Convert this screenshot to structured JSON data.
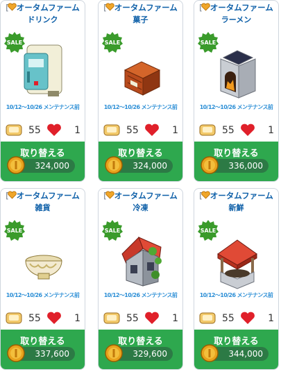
{
  "items": [
    {
      "title": "オータムファーム",
      "subtitle": "ドリンク",
      "sale": "SALE",
      "notice": "10/12～10/26 メンテナンス前",
      "stat_a": "55",
      "stat_b": "1",
      "button": "取り替える",
      "price": "324,000",
      "art": "fridge-icon"
    },
    {
      "title": "オータムファーム",
      "subtitle": "菓子",
      "sale": "SALE",
      "notice": "10/12～10/26 メンテナンス前",
      "stat_a": "55",
      "stat_b": "1",
      "button": "取り替える",
      "price": "324,000",
      "art": "crate-icon"
    },
    {
      "title": "オータムファーム",
      "subtitle": "ラーメン",
      "sale": "SALE",
      "notice": "10/12～10/26 メンテナンス前",
      "stat_a": "55",
      "stat_b": "1",
      "button": "取り替える",
      "price": "336,000",
      "art": "oven-icon"
    },
    {
      "title": "オータムファーム",
      "subtitle": "雑貨",
      "sale": "SALE",
      "notice": "10/12～10/26 メンテナンス前",
      "stat_a": "55",
      "stat_b": "1",
      "button": "取り替える",
      "price": "337,600",
      "art": "bowl-icon"
    },
    {
      "title": "オータムファーム",
      "subtitle": "冷凍",
      "sale": "SALE",
      "notice": "10/12～10/26 メンテナンス前",
      "stat_a": "55",
      "stat_b": "1",
      "button": "取り替える",
      "price": "329,600",
      "art": "house-icon"
    },
    {
      "title": "オータムファーム",
      "subtitle": "新鮮",
      "sale": "SALE",
      "notice": "10/12～10/26 メンテナンス前",
      "stat_a": "55",
      "stat_b": "1",
      "button": "取り替える",
      "price": "344,000",
      "art": "well-icon"
    }
  ],
  "colors": {
    "accent_green": "#2ea84e",
    "pill_green": "#2c7a45",
    "title_blue": "#0d5fa8",
    "notice_blue": "#2d8fd6",
    "sale_green": "#3a9b2b",
    "heart_red": "#e0202a",
    "coin_gold": "#e8a21d"
  }
}
